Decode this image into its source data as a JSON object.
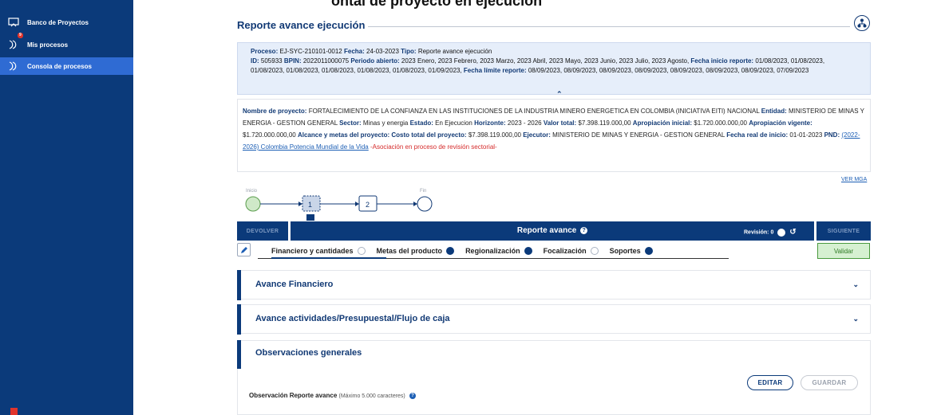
{
  "sidebar": {
    "items": [
      {
        "label": "Banco de Proyectos",
        "icon": "presentation-icon"
      },
      {
        "label": "Mis procesos",
        "icon": "process-icon",
        "badge": "9"
      },
      {
        "label": "Consola de procesos",
        "icon": "console-icon",
        "active": true
      }
    ]
  },
  "header": {
    "cut_title": "ontal de proyecto en ejecución",
    "section_title": "Reporte avance ejecución"
  },
  "info": {
    "proceso_label": "Proceso:",
    "proceso": "EJ-SYC-210101-0012",
    "fecha_label": "Fecha:",
    "fecha": "24-03-2023",
    "tipo_label": "Tipo:",
    "tipo": "Reporte avance ejecución",
    "id_label": "ID:",
    "id": "505933",
    "bpin_label": "BPIN:",
    "bpin": "2022011000075",
    "periodo_label": "Periodo abierto:",
    "periodo": "2023 Enero, 2023 Febrero, 2023 Marzo, 2023 Abril, 2023 Mayo, 2023 Junio, 2023 Julio, 2023 Agosto,",
    "fecha_inicio_label": "Fecha inicio reporte:",
    "fecha_inicio": "01/08/2023, 01/08/2023, 01/08/2023, 01/08/2023, 01/08/2023, 01/08/2023, 01/08/2023, 01/09/2023,",
    "fecha_limite_label": "Fecha límite reporte:",
    "fecha_limite": "08/09/2023, 08/09/2023, 08/09/2023, 08/09/2023, 08/09/2023, 08/09/2023, 08/09/2023, 07/09/2023"
  },
  "project": {
    "nombre_label": "Nombre de proyecto:",
    "nombre": "FORTALECIMIENTO DE LA CONFIANZA EN LAS INSTITUCIONES DE LA INDUSTRIA MINERO ENERGETICA EN COLOMBIA (INICIATIVA EITI) NACIONAL",
    "entidad_label": "Entidad:",
    "entidad": "MINISTERIO DE MINAS Y ENERGIA - GESTION GENERAL",
    "sector_label": "Sector:",
    "sector": "Minas y energia",
    "estado_label": "Estado:",
    "estado": "En Ejecucion",
    "horizonte_label": "Horizonte:",
    "horizonte": "2023 - 2026",
    "valor_label": "Valor total:",
    "valor": "$7.398.119.000,00",
    "apropiacion_inicial_label": "Apropiación inicial:",
    "apropiacion_inicial": "$1.720.000.000,00",
    "apropiacion_vigente_label": "Apropiación vigente:",
    "apropiacion_vigente": "$1.720.000.000,00",
    "alcance_label": "Alcance y metas del proyecto:",
    "costo_label": "Costo total del proyecto:",
    "costo": "$7.398.119.000,00",
    "ejecutor_label": "Ejecutor:",
    "ejecutor": "MINISTERIO DE MINAS Y ENERGIA - GESTION GENERAL",
    "fecha_real_label": "Fecha real de inicio:",
    "fecha_real": "01-01-2023",
    "pnd_label": "PND:",
    "pnd_link": "(2022-2026) Colombia Potencia Mundial de la Vida",
    "asociacion": "-Asociación en proceso de revisión sectorial-"
  },
  "ver_mga": "VER MGA",
  "flow": {
    "inicio": "Inicio",
    "fin": "Fin",
    "step1": "1",
    "step2": "2"
  },
  "bar": {
    "devolver": "DEVOLVER",
    "title": "Reporte avance",
    "revision": "Revisión: 0",
    "siguiente": "SIGUIENTE"
  },
  "tabs": [
    {
      "label": "Financiero y cantidades",
      "state": "empty"
    },
    {
      "label": "Metas del producto",
      "state": "filled"
    },
    {
      "label": "Regionalización",
      "state": "filled"
    },
    {
      "label": "Focalización",
      "state": "empty"
    },
    {
      "label": "Soportes",
      "state": "filled"
    }
  ],
  "validar": "Validar",
  "accordions": {
    "financiero": "Avance Financiero",
    "actividades": "Avance actividades/Presupuestal/Flujo de caja",
    "observaciones": "Observaciones generales"
  },
  "obs": {
    "editar": "EDITAR",
    "guardar": "GUARDAR",
    "label": "Observación Reporte avance",
    "hint": "(Máximo 5.000 caracteres)"
  },
  "colors": {
    "primary": "#0b3a7a",
    "accent": "#2f6bd3",
    "link": "#1d5fb5",
    "warning": "#d52b2b",
    "success": "#4a9a3e"
  }
}
